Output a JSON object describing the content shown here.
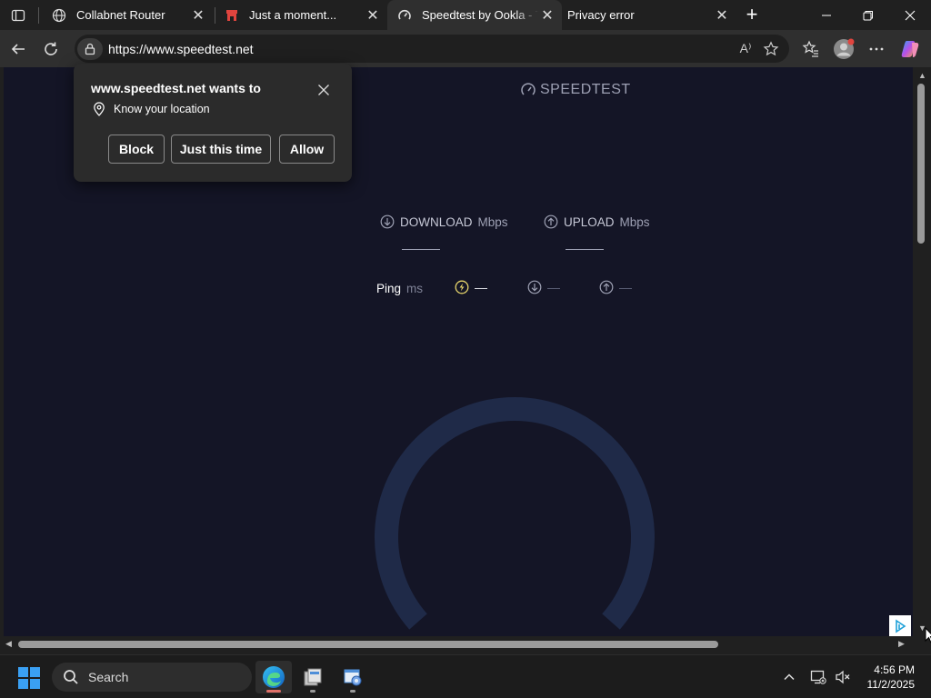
{
  "browser": {
    "tabs": [
      {
        "title": "Collabnet Router",
        "favicon": "globe-icon",
        "active": false
      },
      {
        "title": "Just a moment...",
        "favicon": "red-store-icon",
        "active": false
      },
      {
        "title": "Speedtest by Ookla - The",
        "favicon": "speedtest-gauge-icon",
        "active": true
      },
      {
        "title": "Privacy error",
        "favicon": "none",
        "active": false
      }
    ],
    "new_tab_symbol": "+",
    "url": "https://www.speedtest.net",
    "read_aloud_symbol": "A⁾"
  },
  "permission_popup": {
    "title": "www.speedtest.net wants to",
    "permission": "Know your location",
    "buttons": {
      "block": "Block",
      "just_this_time": "Just this time",
      "allow": "Allow"
    }
  },
  "speedtest": {
    "logo": "SPEEDTEST",
    "download_label": "DOWNLOAD",
    "download_unit": "Mbps",
    "upload_label": "UPLOAD",
    "upload_unit": "Mbps",
    "ping_label": "Ping",
    "ping_unit": "ms",
    "idle_value": "—",
    "down_value": "—",
    "up_value": "—",
    "accent_color": "#e5d36b",
    "gauge_color": "#1f2a48",
    "background_color": "#141526"
  },
  "taskbar": {
    "search_placeholder": "Search",
    "time": "4:56 PM",
    "date": "11/2/2025"
  }
}
